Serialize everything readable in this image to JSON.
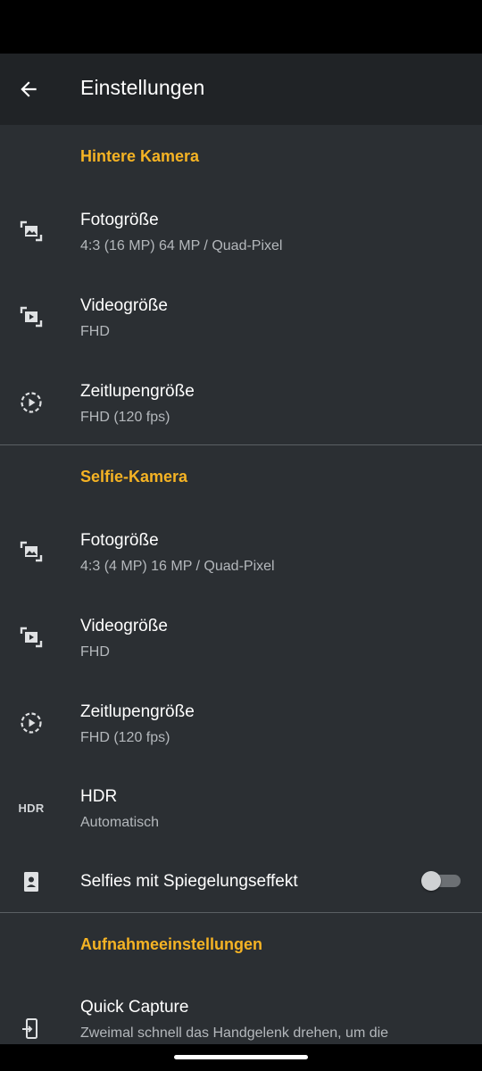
{
  "app_bar": {
    "title": "Einstellungen",
    "back_icon": "arrow-back-icon"
  },
  "sections": {
    "rear": {
      "header": "Hintere Kamera",
      "photo_size": {
        "title": "Fotogröße",
        "value": "4:3 (16 MP) 64 MP / Quad-Pixel"
      },
      "video_size": {
        "title": "Videogröße",
        "value": "FHD"
      },
      "slowmo_size": {
        "title": "Zeitlupengröße",
        "value": "FHD (120 fps)"
      }
    },
    "selfie": {
      "header": "Selfie-Kamera",
      "photo_size": {
        "title": "Fotogröße",
        "value": "4:3 (4 MP) 16 MP / Quad-Pixel"
      },
      "video_size": {
        "title": "Videogröße",
        "value": "FHD"
      },
      "slowmo_size": {
        "title": "Zeitlupengröße",
        "value": "FHD (120 fps)"
      },
      "hdr": {
        "icon_text": "HDR",
        "title": "HDR",
        "value": "Automatisch"
      },
      "mirror": {
        "title": "Selfies mit Spiegelungseffekt",
        "enabled": false
      }
    },
    "capture": {
      "header": "Aufnahmeeinstellungen",
      "quick_capture": {
        "title": "Quick Capture",
        "value": "Zweimal schnell das Handgelenk drehen, um die"
      }
    }
  },
  "colors": {
    "accent": "#f5b324",
    "background": "#2b2f33",
    "app_bar": "#202326"
  }
}
